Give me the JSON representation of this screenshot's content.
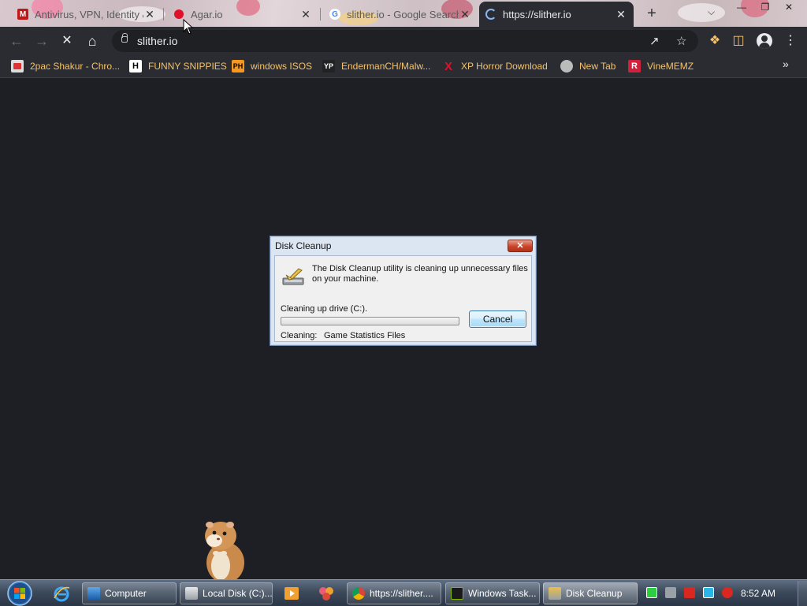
{
  "browser": {
    "tabs": [
      {
        "title": "Antivirus, VPN, Identity &",
        "icon": "mcafee-icon",
        "active": false
      },
      {
        "title": "Agar.io",
        "icon": "red-dot-icon",
        "active": false
      },
      {
        "title": "slither.io - Google Search",
        "icon": "google-icon",
        "active": false
      },
      {
        "title": "https://slither.io",
        "icon": "loading-icon",
        "active": true
      }
    ],
    "tab_close_glyph": "✕",
    "new_tab_glyph": "+",
    "url": "slither.io"
  },
  "bookmarks": [
    {
      "label": "2pac Shakur - Chro...",
      "icon": "bookmark-favicon"
    },
    {
      "label": "FUNNY SNIPPIES",
      "icon": "h-icon"
    },
    {
      "label": "windows ISOS",
      "icon": "ph-icon"
    },
    {
      "label": "EndermanCH/Malw...",
      "icon": "yp-icon"
    },
    {
      "label": "XP Horror Download",
      "icon": "x-icon"
    },
    {
      "label": "New Tab",
      "icon": "globe-icon"
    },
    {
      "label": "VineMEMZ",
      "icon": "r-icon"
    }
  ],
  "dialog": {
    "title": "Disk Cleanup",
    "close_glyph": "✕",
    "message": "The Disk Cleanup utility is cleaning up unnecessary files on your machine.",
    "drive_text": "Cleaning up drive  (C:).",
    "progress_fraction": 0.0,
    "cleaning_label": "Cleaning:",
    "cleaning_value": "Game Statistics Files",
    "cancel_label": "Cancel"
  },
  "taskbar": {
    "buttons": [
      {
        "label": "Computer",
        "icon": "computer-icon",
        "active": false
      },
      {
        "label": "Local Disk (C:)...",
        "icon": "folder-icon",
        "active": false
      },
      {
        "label": "https://slither....",
        "icon": "chrome-icon",
        "active": false
      },
      {
        "label": "Windows Task...",
        "icon": "task-manager-icon",
        "active": false
      },
      {
        "label": "Disk Cleanup",
        "icon": "disk-cleanup-icon",
        "active": true
      }
    ],
    "clock": "8:52 AM"
  },
  "colors": {
    "bookmark_text": "#f5c26b",
    "page_background": "#1d1f24",
    "chrome_dark": "#2a2c31"
  }
}
